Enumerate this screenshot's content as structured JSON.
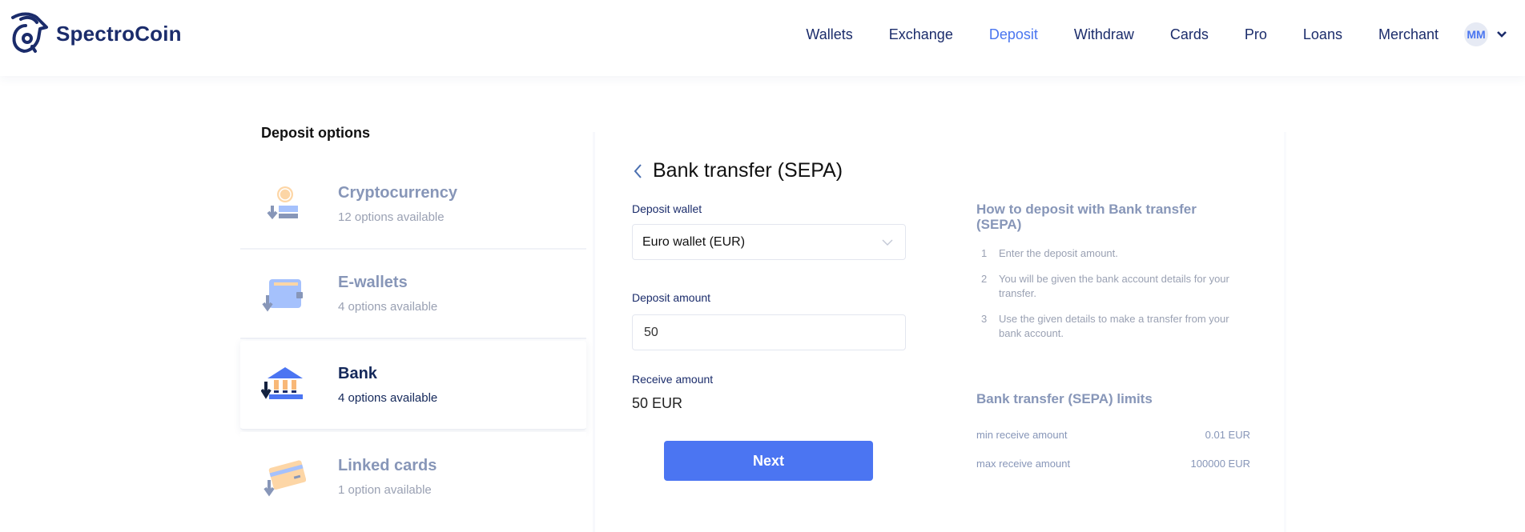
{
  "brand": {
    "name": "SpectroCoin",
    "accent": "#4b75f2",
    "navy": "#1b2c6b"
  },
  "nav": {
    "items": [
      {
        "label": "Wallets",
        "active": false
      },
      {
        "label": "Exchange",
        "active": false
      },
      {
        "label": "Deposit",
        "active": true
      },
      {
        "label": "Withdraw",
        "active": false
      },
      {
        "label": "Cards",
        "active": false
      },
      {
        "label": "Pro",
        "active": false
      },
      {
        "label": "Loans",
        "active": false
      },
      {
        "label": "Merchant",
        "active": false
      }
    ],
    "avatar_initials": "MM"
  },
  "sidebar": {
    "title": "Deposit options",
    "options": [
      {
        "title": "Cryptocurrency",
        "subtitle": "12 options available",
        "icon": "crypto-deposit-icon",
        "selected": false
      },
      {
        "title": "E-wallets",
        "subtitle": "4 options available",
        "icon": "ewallet-deposit-icon",
        "selected": false
      },
      {
        "title": "Bank",
        "subtitle": "4 options available",
        "icon": "bank-deposit-icon",
        "selected": true
      },
      {
        "title": "Linked cards",
        "subtitle": "1 option available",
        "icon": "card-deposit-icon",
        "selected": false
      }
    ]
  },
  "form": {
    "title": "Bank transfer (SEPA)",
    "deposit_wallet_label": "Deposit wallet",
    "deposit_wallet_value": "Euro wallet (EUR)",
    "deposit_amount_label": "Deposit amount",
    "deposit_amount_value": "50",
    "receive_amount_label": "Receive amount",
    "receive_amount_value": "50 EUR",
    "next_label": "Next"
  },
  "howto": {
    "title": "How to deposit with Bank transfer (SEPA)",
    "steps": [
      {
        "num": "1",
        "text": "Enter the deposit amount."
      },
      {
        "num": "2",
        "text": "You will be given the bank account details for your transfer."
      },
      {
        "num": "3",
        "text": "Use the given details to make a transfer from your bank account."
      }
    ]
  },
  "limits": {
    "title": "Bank transfer (SEPA) limits",
    "rows": [
      {
        "label": "min receive amount",
        "value": "0.01 EUR"
      },
      {
        "label": "max receive amount",
        "value": "100000 EUR"
      }
    ]
  }
}
